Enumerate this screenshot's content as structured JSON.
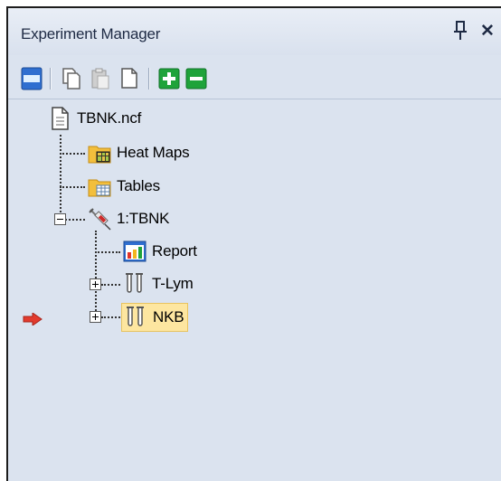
{
  "panel": {
    "title": "Experiment Manager"
  },
  "tree": {
    "root": {
      "label": "TBNK.ncf",
      "icon": "document-icon"
    },
    "items": [
      {
        "label": "Heat Maps",
        "icon": "heatmap-folder-icon"
      },
      {
        "label": "Tables",
        "icon": "table-folder-icon"
      },
      {
        "label": "1:TBNK",
        "icon": "syringe-icon",
        "expanded": true
      },
      {
        "label": "Report",
        "icon": "report-chart-icon"
      },
      {
        "label": "T-Lym",
        "icon": "test-tubes-icon",
        "expanded": false
      },
      {
        "label": "NKB",
        "icon": "test-tubes-icon",
        "expanded": false,
        "selected": true
      }
    ]
  },
  "colors": {
    "panel_bg": "#dbe3ef",
    "selection": "#fde6a0",
    "pointer_arrow": "#e23b2e",
    "add_green": "#1fa33a"
  }
}
